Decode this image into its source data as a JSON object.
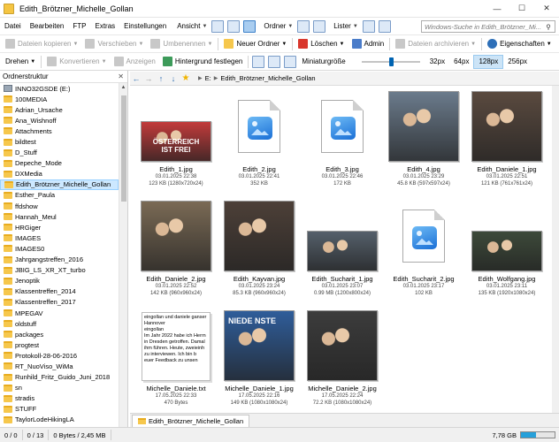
{
  "window": {
    "title": "Edith_Brötzner_Michelle_Gollan"
  },
  "menu": {
    "items": [
      "Datei",
      "Bearbeiten",
      "FTP",
      "Extras",
      "Einstellungen"
    ],
    "ansicht": "Ansicht",
    "ordner": "Ordner",
    "lister": "Lister",
    "search_placeholder": "Windows-Suche in Edith_Brötzner_Mi..."
  },
  "toolbar1": {
    "copy": "Dateien kopieren",
    "move": "Verschieben",
    "rename": "Umbenennen",
    "new_folder": "Neuer Ordner",
    "delete": "Löschen",
    "admin": "Admin",
    "archive": "Dateien archivieren",
    "properties": "Eigenschaften"
  },
  "toolbar2": {
    "rotate": "Drehen",
    "convert": "Konvertieren",
    "show": "Anzeigen",
    "set_background": "Hintergrund festlegen",
    "thumb_size_label": "Miniaturgröße",
    "sizes": [
      "32px",
      "64px",
      "128px",
      "256px"
    ],
    "active_size": "128px"
  },
  "left_panel": {
    "header": "Ordnerstruktur",
    "drive": "INNO32GSDE (E:)",
    "folders": [
      "100MEDIA",
      "Adrian_Ursache",
      "Ana_Wishnoff",
      "Attachments",
      "bildtest",
      "D_Stuff",
      "Depeche_Mode",
      "DXMedia",
      "Edith_Brötzner_Michelle_Gollan",
      "Esther_Paula",
      "ffdshow",
      "Hannah_Meul",
      "HRGiger",
      "IMAGES",
      "IMAGES0",
      "Jahrgangstreffen_2016",
      "JBIG_LS_XR_XT_turbo",
      "Jenoptik",
      "Klassentreffen_2014",
      "Klassentreffen_2017",
      "MPEGAV",
      "oldstuff",
      "packages",
      "progtest",
      "Protokoll-28-06-2016",
      "RT_NuoViso_WiMa",
      "Runhild_Fritz_Guido_Juni_2018",
      "sn",
      "stradis",
      "STUFF",
      "TaylorLodeHikingLA"
    ],
    "selected_index": 8
  },
  "address": {
    "drive": "E:",
    "folder": "Edith_Brötzner_Michelle_Gollan"
  },
  "files": [
    {
      "name": "Edith_1.jpg",
      "date": "03.01.2025 22:38",
      "meta": "123 KB (1280x720x24)",
      "kind": "photo",
      "color": "#c23b3b"
    },
    {
      "name": "Edith_2.jpg",
      "date": "03.01.2025 22:41",
      "meta": "352 KB",
      "kind": "doc"
    },
    {
      "name": "Edith_3.jpg",
      "date": "03.01.2025 22:46",
      "meta": "172 KB",
      "kind": "doc"
    },
    {
      "name": "Edith_4.jpg",
      "date": "03.01.2025 23:29",
      "meta": "45.8 KB (597x597x24)",
      "kind": "photo",
      "color": "#6b7b8c"
    },
    {
      "name": "Edith_Daniele_1.jpg",
      "date": "03.01.2025 22:51",
      "meta": "121 KB (761x761x24)",
      "kind": "photo",
      "color": "#5a4a3f"
    },
    {
      "name": "Edith_Daniele_2.jpg",
      "date": "03.01.2025 22:52",
      "meta": "142 KB (960x960x24)",
      "kind": "photo",
      "color": "#7a6a55"
    },
    {
      "name": "Edith_Kayvan.jpg",
      "date": "03.01.2025 23:24",
      "meta": "85.3 KB (960x960x24)",
      "kind": "photo",
      "color": "#4d4038"
    },
    {
      "name": "Edith_Sucharit_1.jpg",
      "date": "03.01.2025 23:07",
      "meta": "0.99 MB (1200x800x24)",
      "kind": "photo",
      "color": "#55606b"
    },
    {
      "name": "Edith_Sucharit_2.jpg",
      "date": "03.01.2025 23:17",
      "meta": "102 KB",
      "kind": "doc"
    },
    {
      "name": "Edith_Wolfgang.jpg",
      "date": "03.01.2025 23:11",
      "meta": "135 KB (1920x1080x24)",
      "kind": "photo",
      "color": "#3d4a3a"
    },
    {
      "name": "Michelle_Daniele.txt",
      "date": "17.05.2025 22:33",
      "meta": "470 Bytes",
      "kind": "text"
    },
    {
      "name": "Michelle_Daniele_1.jpg",
      "date": "17.05.2025 22:16",
      "meta": "149 KB (1080x1080x24)",
      "kind": "photo",
      "color": "#2f5d9a"
    },
    {
      "name": "Michelle_Daniele_2.jpg",
      "date": "17.05.2025 22:24",
      "meta": "72.2 KB (1080x1080x24)",
      "kind": "photo",
      "color": "#3c3c3c"
    }
  ],
  "text_preview": [
    "eingollan und daniele ganser",
    "Hannover",
    "",
    "eingollan",
    "",
    "Im Jahr 2022 habe ich Herrn",
    "in Dresden getroffen. Damal",
    "ihm führen. Heute, zweieinh",
    "zu interviewen. Ich bin b",
    "euer Feedback zu unsen"
  ],
  "thumb_overlays": {
    "edith1_caption": "ÖSTERREICH IST FREI",
    "michelle1_caption": "NIEDE NSTE"
  },
  "tab": {
    "label": "Edith_Brötzner_Michelle_Gollan"
  },
  "status": {
    "selection": "0 / 0",
    "files": "0 / 13",
    "size": "0 Bytes / 2,45 MB",
    "disk_free": "7,78 GB",
    "disk_used_fraction": 0.45
  }
}
